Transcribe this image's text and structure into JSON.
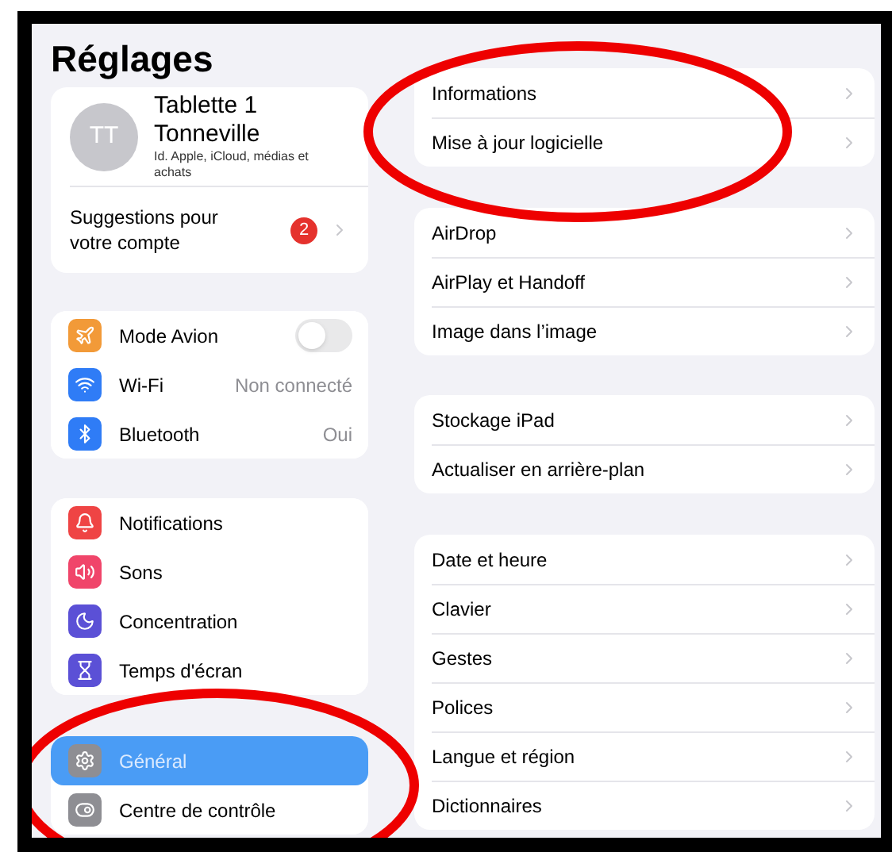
{
  "title": "Réglages",
  "profile": {
    "initials": "TT",
    "name": "Tablette 1 Tonneville",
    "subtitle": "Id. Apple, iCloud, médias et achats",
    "suggestion": "Suggestions pour votre compte",
    "badge": "2"
  },
  "sidebar_groups": [
    [
      {
        "label": "Mode Avion",
        "kind": "toggle",
        "on": false,
        "selected": false,
        "color": "#f29a38"
      },
      {
        "label": "Wi-Fi",
        "kind": "value",
        "value": "Non connecté",
        "selected": false,
        "color": "#2f7cf6"
      },
      {
        "label": "Bluetooth",
        "kind": "value",
        "value": "Oui",
        "selected": false,
        "color": "#2f7cf6"
      }
    ],
    [
      {
        "label": "Notifications",
        "kind": "plain",
        "selected": false,
        "color": "#ef4444"
      },
      {
        "label": "Sons",
        "kind": "plain",
        "selected": false,
        "color": "#f0456a"
      },
      {
        "label": "Concentration",
        "kind": "plain",
        "selected": false,
        "color": "#5b50d6"
      },
      {
        "label": "Temps d'écran",
        "kind": "plain",
        "selected": false,
        "color": "#5b50d6"
      }
    ],
    [
      {
        "label": "Général",
        "kind": "plain",
        "selected": true,
        "color": "#8e8e93"
      },
      {
        "label": "Centre de contrôle",
        "kind": "plain",
        "selected": false,
        "color": "#8e8e93"
      }
    ]
  ],
  "detail_groups": [
    [
      {
        "label": "Informations"
      },
      {
        "label": "Mise à jour logicielle"
      }
    ],
    [
      {
        "label": "AirDrop"
      },
      {
        "label": "AirPlay et Handoff"
      },
      {
        "label": "Image dans l’image"
      }
    ],
    [
      {
        "label": "Stockage iPad"
      },
      {
        "label": "Actualiser en arrière-plan"
      }
    ],
    [
      {
        "label": "Date et heure"
      },
      {
        "label": "Clavier"
      },
      {
        "label": "Gestes"
      },
      {
        "label": "Polices"
      },
      {
        "label": "Langue et région"
      },
      {
        "label": "Dictionnaires"
      }
    ]
  ],
  "annotations": [
    {
      "kind": "ellipse"
    },
    {
      "kind": "ellipse"
    }
  ]
}
